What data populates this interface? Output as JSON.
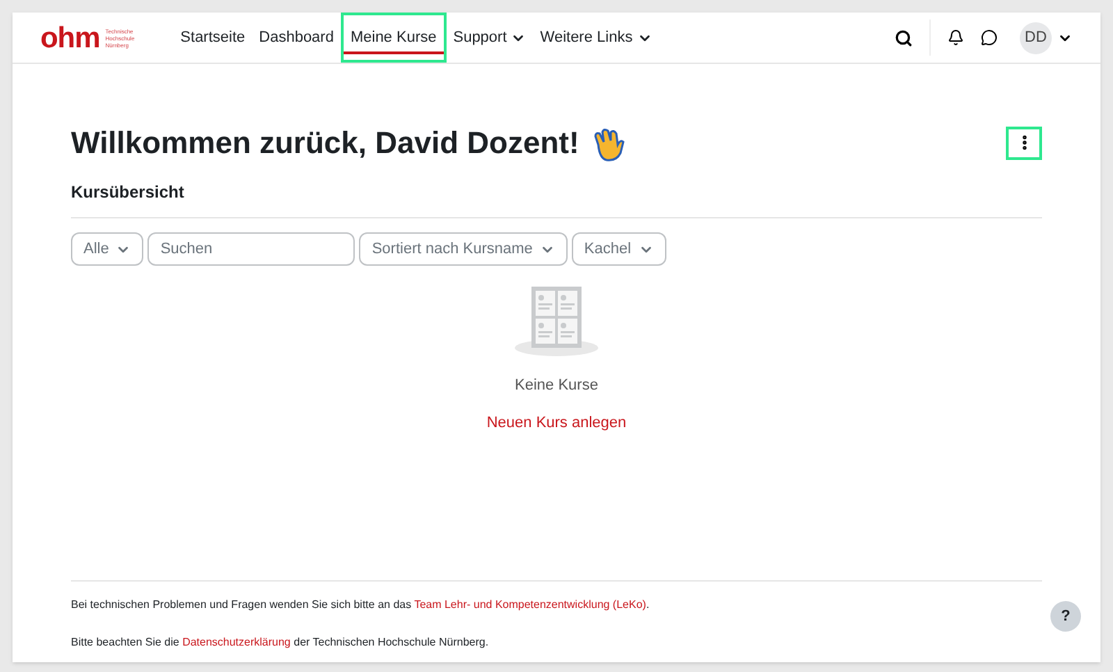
{
  "logo": {
    "mark": "ohm",
    "lines": [
      "Technische",
      "Hochschule",
      "Nürnberg"
    ]
  },
  "nav": [
    {
      "label": "Startseite",
      "selected": false,
      "dropdown": false,
      "highlighted": false
    },
    {
      "label": "Dashboard",
      "selected": false,
      "dropdown": false,
      "highlighted": false
    },
    {
      "label": "Meine Kurse",
      "selected": true,
      "dropdown": false,
      "highlighted": true
    },
    {
      "label": "Support",
      "selected": false,
      "dropdown": true,
      "highlighted": false
    },
    {
      "label": "Weitere Links",
      "selected": false,
      "dropdown": true,
      "highlighted": false
    }
  ],
  "user": {
    "initials": "DD"
  },
  "heading": "Willkommen zurück, David Dozent!",
  "page_menu": {
    "highlighted": true
  },
  "section_title": "Kursübersicht",
  "filters": [
    {
      "kind": "select",
      "label": "Alle"
    },
    {
      "kind": "search",
      "placeholder": "Suchen"
    },
    {
      "kind": "select",
      "label": "Sortiert nach Kursname"
    },
    {
      "kind": "select",
      "label": "Kachel"
    }
  ],
  "empty": {
    "message": "Keine Kurse",
    "action": "Neuen Kurs anlegen"
  },
  "footer": [
    {
      "before": "Bei technischen Problemen und Fragen wenden Sie sich bitte an das ",
      "link": "Team Lehr- und Kompetenzentwicklung (LeKo)",
      "after": "."
    },
    {
      "before": "Bitte beachten Sie die ",
      "link": "Datenschutzerklärung",
      "after": " der Technischen Hochschule Nürnberg."
    }
  ],
  "help": {
    "label": "?"
  }
}
